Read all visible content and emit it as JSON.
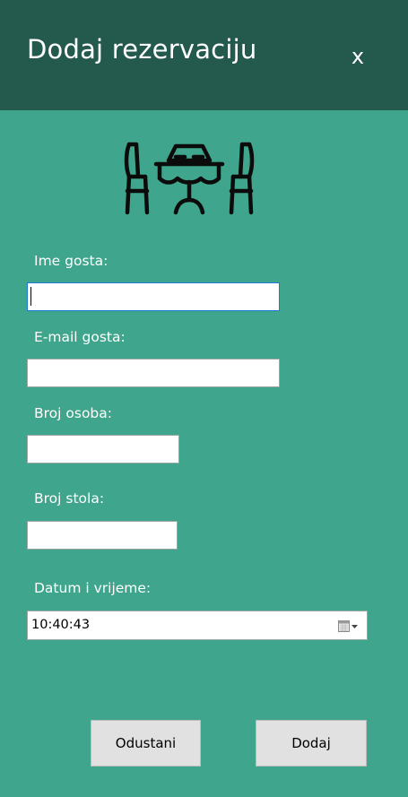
{
  "window": {
    "title": "Dodaj rezervaciju",
    "close_label": "x"
  },
  "header": {
    "icon": "dining-table-icon"
  },
  "form": {
    "guest_name": {
      "label": "Ime gosta:",
      "value": ""
    },
    "guest_email": {
      "label": "E-mail gosta:",
      "value": ""
    },
    "persons": {
      "label": "Broj osoba:",
      "value": ""
    },
    "table": {
      "label": "Broj stola:",
      "value": ""
    },
    "datetime": {
      "label": "Datum i vrijeme:",
      "value": "10:40:43",
      "icon": "calendar-dropdown-icon"
    }
  },
  "buttons": {
    "cancel": "Odustani",
    "add": "Dodaj"
  },
  "colors": {
    "background": "#3fa58c",
    "header": "#245a4d",
    "button": "#e1e1e1"
  }
}
